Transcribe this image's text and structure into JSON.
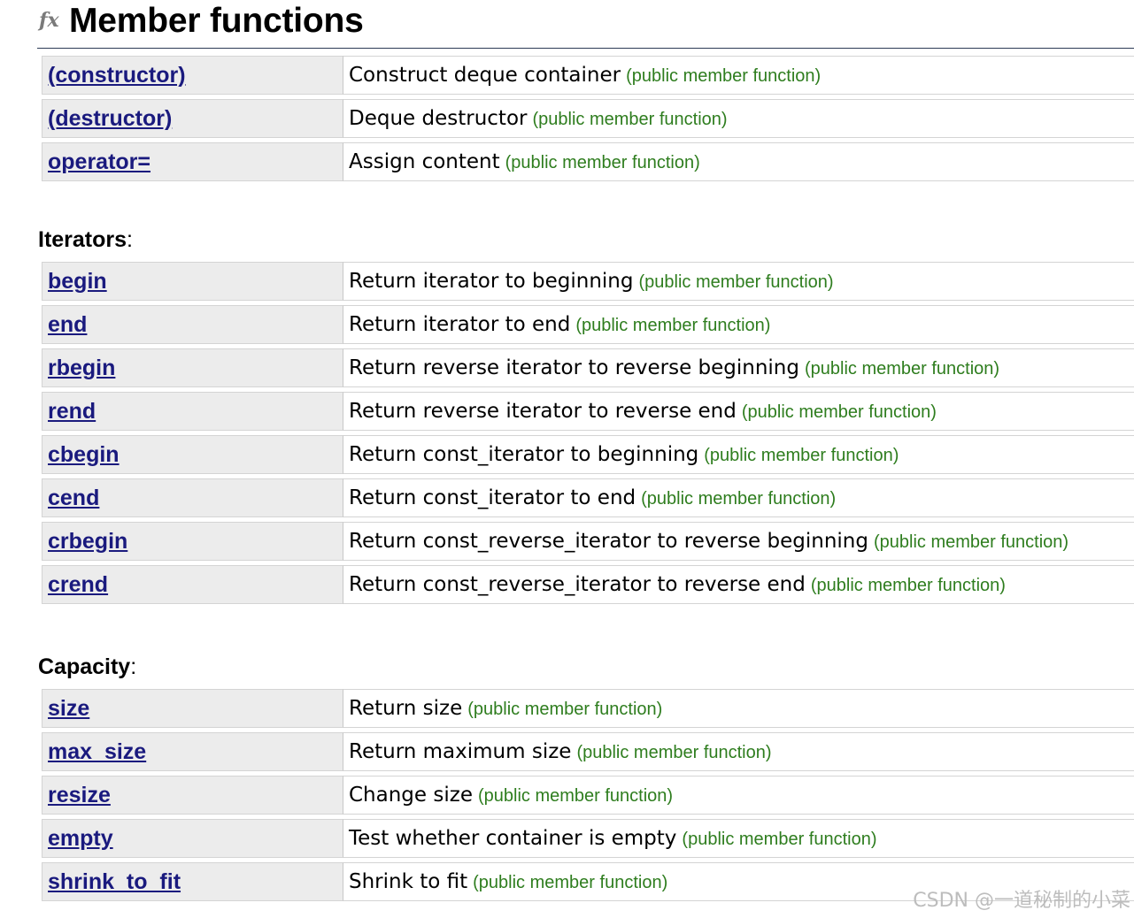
{
  "section": {
    "icon": "fx",
    "title": "Member functions"
  },
  "kind_label": "(public member function)",
  "groups": [
    {
      "label": "",
      "items": [
        {
          "name": "(constructor)",
          "desc": "Construct deque container",
          "kind": "(public member function)"
        },
        {
          "name": "(destructor)",
          "desc": "Deque destructor",
          "kind": "(public member function)"
        },
        {
          "name": "operator=",
          "desc": "Assign content",
          "kind": "(public member function)"
        }
      ]
    },
    {
      "label": "Iterators",
      "items": [
        {
          "name": "begin",
          "desc": "Return iterator to beginning",
          "kind": "(public member function)"
        },
        {
          "name": "end",
          "desc": "Return iterator to end",
          "kind": "(public member function)"
        },
        {
          "name": "rbegin",
          "desc": "Return reverse iterator to reverse beginning",
          "kind": "(public member function)"
        },
        {
          "name": "rend",
          "desc": "Return reverse iterator to reverse end",
          "kind": "(public member function)"
        },
        {
          "name": "cbegin",
          "desc": "Return const_iterator to beginning",
          "kind": "(public member function)"
        },
        {
          "name": "cend",
          "desc": "Return const_iterator to end",
          "kind": "(public member function)"
        },
        {
          "name": "crbegin",
          "desc": "Return const_reverse_iterator to reverse beginning",
          "kind": "(public member function)"
        },
        {
          "name": "crend",
          "desc": "Return const_reverse_iterator to reverse end",
          "kind": "(public member function)"
        }
      ]
    },
    {
      "label": "Capacity",
      "items": [
        {
          "name": "size",
          "desc": "Return size",
          "kind": "(public member function)"
        },
        {
          "name": "max_size",
          "desc": "Return maximum size",
          "kind": "(public member function)"
        },
        {
          "name": "resize",
          "desc": "Change size",
          "kind": "(public member function)"
        },
        {
          "name": "empty",
          "desc": "Test whether container is empty",
          "kind": "(public member function)"
        },
        {
          "name": "shrink_to_fit",
          "desc": "Shrink to fit",
          "kind": "(public member function)"
        }
      ]
    }
  ],
  "watermark": "CSDN @一道秘制的小菜",
  "colors": {
    "link": "#1a1a7e",
    "kind": "#2e7d1e",
    "name_cell_bg": "#ececec"
  }
}
